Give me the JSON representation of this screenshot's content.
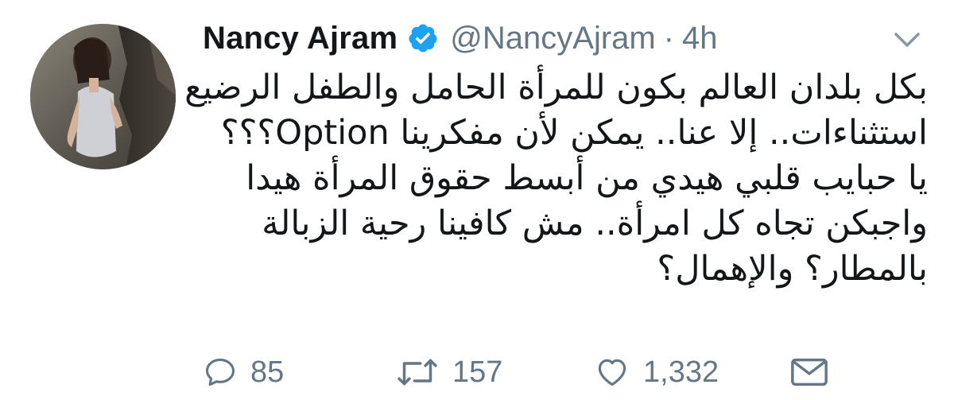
{
  "author": {
    "display_name": "Nancy Ajram",
    "handle": "@NancyAjram",
    "separator": "·",
    "time": "4h",
    "verified": true
  },
  "tweet": {
    "lines": [
      "بكل بلدان العالم بكون للمرأة الحامل والطفل الرضيع",
      "استثناءات.. إلا عنا.. يمكن لأن مفكرينا Option؟؟؟",
      "يا حبايب قلبي هيدي من أبسط حقوق المرأة هيدا",
      "واجبكن تجاه كل امرأة.. مش كافينا رحية الزبالة",
      "بالمطار؟ والإهمال؟"
    ]
  },
  "actions": {
    "reply_count": "85",
    "retweet_count": "157",
    "like_count": "1,332"
  },
  "icons": {
    "verified": "verified-badge-icon",
    "caret": "chevron-down-icon",
    "reply": "reply-icon",
    "retweet": "retweet-icon",
    "like": "heart-icon",
    "dm": "envelope-icon"
  },
  "colors": {
    "text": "#14171a",
    "secondary": "#657786",
    "verified": "#1da1f2"
  }
}
